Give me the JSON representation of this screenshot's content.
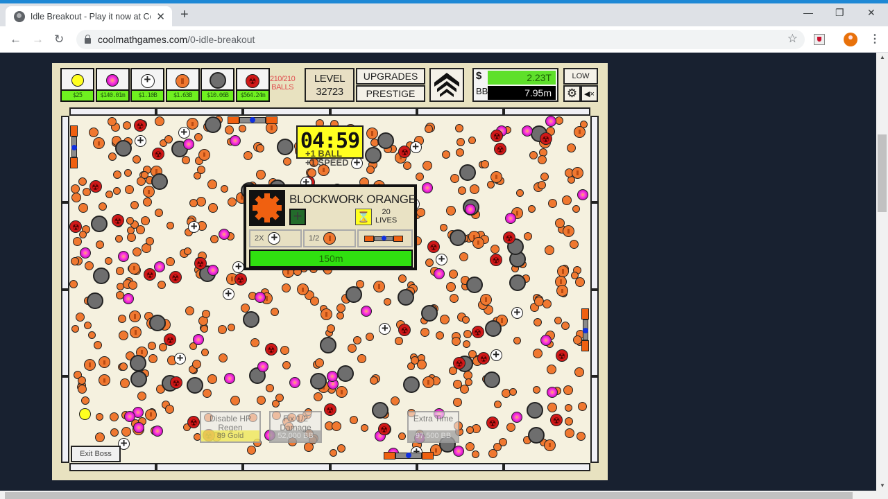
{
  "browser": {
    "tab_title": "Idle Breakout - Play it now at Coolmath Games",
    "tab_title_visible": "Idle Breakout - Play it now at Coo",
    "new_tab_label": "+",
    "url_host": "coolmathgames.com",
    "url_path": "/0-idle-breakout",
    "window_controls": [
      "minimize",
      "restore",
      "close"
    ]
  },
  "hud": {
    "ball_shop": [
      {
        "type": "basic",
        "icon": "yellow-ball",
        "color": "#ffff20",
        "price": "$25"
      },
      {
        "type": "plasma",
        "icon": "pink-ball",
        "color": "#ff40e0",
        "price": "$140.01m"
      },
      {
        "type": "sniper",
        "icon": "plus-ball",
        "color": "#ffffff",
        "price": "$1.10B"
      },
      {
        "type": "scatter",
        "icon": "orange-ball",
        "color": "#f07830",
        "price": "$1.63B"
      },
      {
        "type": "cannon",
        "icon": "gray-ball",
        "color": "#6e6e6e",
        "price": "$10.06B"
      },
      {
        "type": "poison",
        "icon": "red-ball",
        "color": "#d01818",
        "price": "$564.24m"
      }
    ],
    "balls_count": "210/210",
    "balls_label": "BALLS",
    "level_label": "LEVEL",
    "level_value": "32723",
    "upgrades_label": "UPGRADES",
    "prestige_label": "PRESTIGE",
    "money_label": "$",
    "money_value": "2.23T",
    "bb_label": "BB",
    "bb_value": "7.95m",
    "quality_label": "LOW",
    "settings_icon": "gear-icon",
    "mute_icon": "speaker-muted-icon"
  },
  "boss": {
    "timer": "04:59",
    "timer_ghost_lines": [
      "+1 BALL",
      "+1 SPEED"
    ],
    "name": "BLOCKWORK ORANGE",
    "lives_value": "20",
    "lives_label": "LIVES",
    "modifiers": [
      {
        "label": "2X",
        "icon": "plus-ball"
      },
      {
        "label": "1/2",
        "icon": "orange-ball"
      },
      {
        "label": "",
        "icon": "paddle"
      }
    ],
    "hp": "150m",
    "exit_label": "Exit Boss"
  },
  "powerups": [
    {
      "title": "Disable HP Regen",
      "cost": "89 Gold"
    },
    {
      "title": "Fix 1/2 Damage",
      "cost": "52,000 BB"
    },
    {
      "title": "Extra Time",
      "cost": "97,500 BB"
    }
  ]
}
